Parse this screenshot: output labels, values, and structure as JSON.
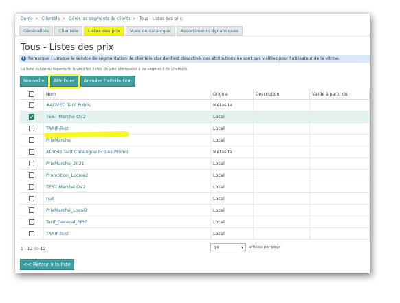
{
  "breadcrumb": [
    "Demo",
    "Clientèle",
    "Gérer les segments de clients",
    "Tous - Listes des prix"
  ],
  "tabs": [
    "Généralités",
    "Clientèle",
    "Listes des prix",
    "Vues de catalogue",
    "Assortiments dynamiques"
  ],
  "page_title": "Tous - Listes des prix",
  "note": "Remarque : Lorsque le service de segmentation de clientèle standard est désactivé, ces attributions ne sont pas visibles pour l'utilisateur de la vitrine.",
  "description": "La liste suivante répertorie toutes les listes de prix attribuées à ce segment de clientèle.",
  "buttons": {
    "new": "Nouvelle",
    "assign": "Attribuer",
    "unassign": "Annuler l'attribution"
  },
  "columns": [
    "Nom",
    "Origine",
    "Description",
    "Valide à partir du"
  ],
  "rows": [
    {
      "name": "#ADVEO Tarif Public",
      "origin": "Métasite",
      "checked": false
    },
    {
      "name": "TEST Marché OV2",
      "origin": "Local",
      "checked": true
    },
    {
      "name": "TARIF-Test",
      "origin": "Local",
      "checked": false
    },
    {
      "name": "PrixMarche",
      "origin": "Local",
      "checked": false
    },
    {
      "name": "ADVEO Tarif Catalogue Ecoles Promo",
      "origin": "Métasite",
      "checked": false
    },
    {
      "name": "PrixMarche_2021",
      "origin": "Local",
      "checked": false
    },
    {
      "name": "Promotion_Locale2",
      "origin": "Local",
      "checked": false
    },
    {
      "name": "TEST Marché OV2",
      "origin": "Local",
      "checked": false
    },
    {
      "name": "null",
      "origin": "Local",
      "checked": false
    },
    {
      "name": "PrixMarché_Local2",
      "origin": "Local",
      "checked": false
    },
    {
      "name": "Tarif_General_PME",
      "origin": "Local",
      "checked": false
    },
    {
      "name": "TARIF-Test",
      "origin": "Local",
      "checked": false
    }
  ],
  "pager": {
    "range": "1 - 12",
    "of": "de",
    "total": "12"
  },
  "per_page": {
    "value": "15",
    "label": "articles par page"
  },
  "back_button": "<< Retour à la liste",
  "colors": {
    "accent": "#3f9ea0",
    "highlight": "#f4f50a",
    "link": "#2b7a90"
  }
}
